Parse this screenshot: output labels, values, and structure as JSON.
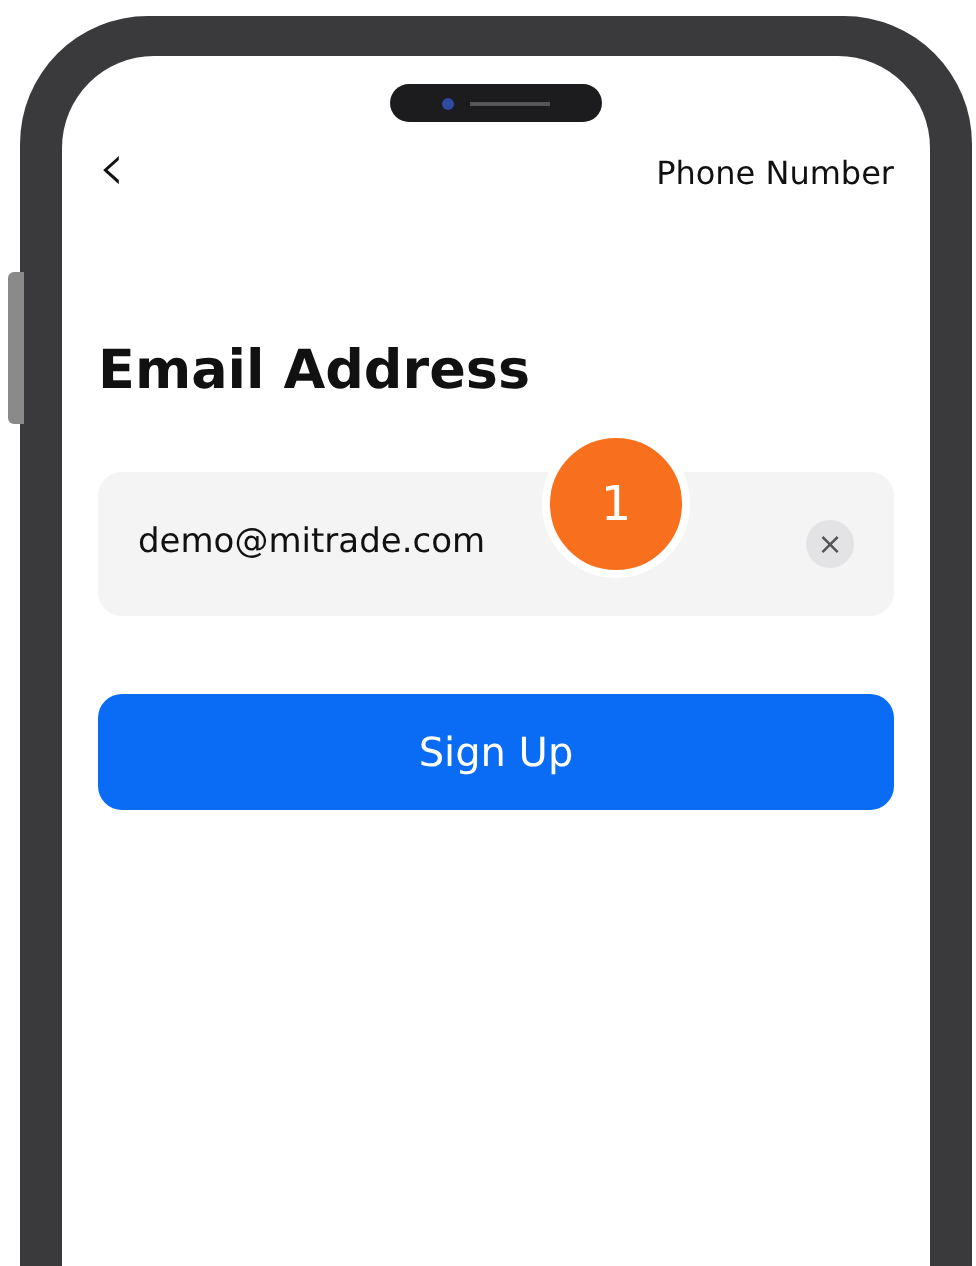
{
  "nav": {
    "back": "‹",
    "switch_link": "Phone Number"
  },
  "title": "Email Address",
  "email_field": {
    "value": "demo@mitrade.com",
    "clear": "×"
  },
  "step_marker": "1",
  "buttons": [
    "Sign Up"
  ]
}
